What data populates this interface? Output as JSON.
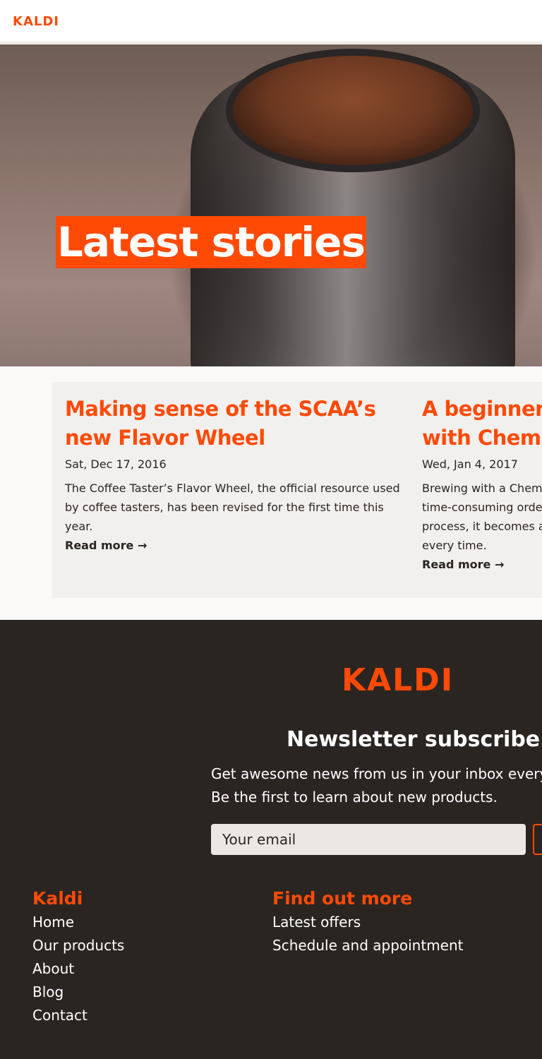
{
  "nav": {
    "logo": "KALDI"
  },
  "hero": {
    "title": "Latest stories"
  },
  "stories": [
    {
      "title": "Making sense of the SCAA’s new Flavor Wheel",
      "date": "Sat, Dec 17, 2016",
      "excerpt": "The Coffee Taster’s Flavor Wheel, the official resource used by coffee tasters, has been revised for the first time this year.",
      "read_more": "Read more →"
    },
    {
      "title": "A beginner’s guide to brewing with Chemex",
      "date": "Wed, Jan 4, 2017",
      "excerpt": "Brewing with a Chemex probably seems like a complicated, time-consuming ordeal, but once you get used to the process, it becomes a soothing ritual that's worth the effort every time.",
      "read_more": "Read more →"
    }
  ],
  "footer": {
    "logo": "KALDI",
    "newsletter_title": "Newsletter subscribe",
    "newsletter_text": "Get awesome news from us in your inbox every other weeks. Be the first to learn about new products.",
    "email_placeholder": "Your email",
    "columns": [
      {
        "title": "Kaldi",
        "links": [
          "Home",
          "Our products",
          "About",
          "Blog",
          "Contact"
        ]
      },
      {
        "title": "Find out more",
        "links": [
          "Latest offers",
          "Schedule and appointment"
        ]
      }
    ]
  },
  "colors": {
    "accent": "#ff4a05",
    "footer_bg": "#2b2522",
    "panel_bg": "#f2f0ee"
  }
}
